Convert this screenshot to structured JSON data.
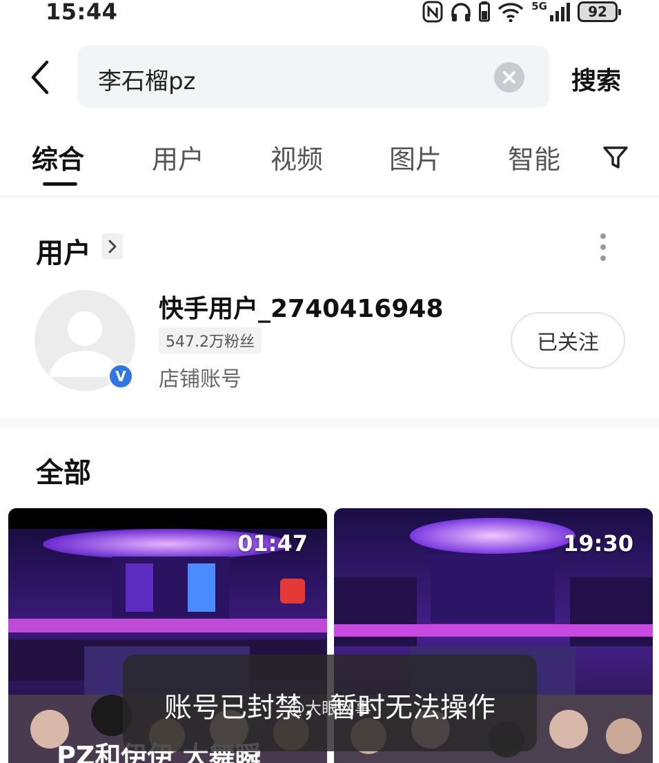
{
  "status_bar": {
    "time": "15:44",
    "network": "5G",
    "battery": "92",
    "icons": [
      "nfc-icon",
      "headphones-icon",
      "battery-small-icon",
      "wifi-icon",
      "cellular-signal-icon",
      "battery-icon"
    ]
  },
  "search": {
    "query": "李石榴pz",
    "button_label": "搜索"
  },
  "tabs": [
    {
      "label": "综合",
      "active": true
    },
    {
      "label": "用户",
      "active": false
    },
    {
      "label": "视频",
      "active": false
    },
    {
      "label": "图片",
      "active": false
    },
    {
      "label": "智能",
      "active": false
    }
  ],
  "users_section": {
    "title": "用户",
    "user": {
      "name": "快手用户_2740416948",
      "followers": "547.2万粉丝",
      "account_type": "店铺账号",
      "verified_mark": "V",
      "follow_label": "已关注"
    }
  },
  "all_section": {
    "title": "全部",
    "videos": [
      {
        "duration": "01:47",
        "caption": "PZ和伊伊 大舞瞬"
      },
      {
        "duration": "19:30"
      }
    ]
  },
  "toast": {
    "message": "账号已封禁，暂时无法操作",
    "watermark": "@大眼网事"
  },
  "colors": {
    "accent_blue": "#2f76e6",
    "stage_purple": "#8a3cf0",
    "toast_bg": "#282828"
  }
}
